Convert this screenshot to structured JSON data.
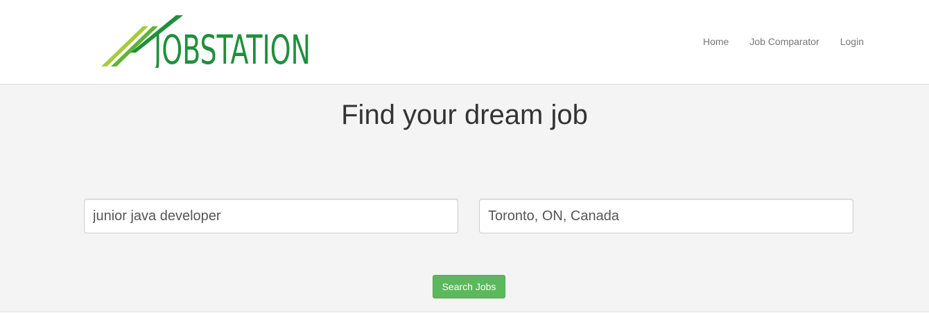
{
  "brand": {
    "logo_text": "JOBSTATION",
    "colors": {
      "stripe_light": "#a6cc39",
      "stripe_mid": "#5fb336",
      "stripe_dark": "#1e8f3c",
      "text": "#1e8f3c"
    }
  },
  "nav": {
    "items": [
      {
        "label": "Home"
      },
      {
        "label": "Job Comparator"
      },
      {
        "label": "Login"
      }
    ]
  },
  "hero": {
    "title": "Find your dream job"
  },
  "search": {
    "what_value": "junior java developer",
    "where_value": "Toronto, ON, Canada",
    "button_label": "Search Jobs",
    "button_color": "#5cb85c"
  }
}
